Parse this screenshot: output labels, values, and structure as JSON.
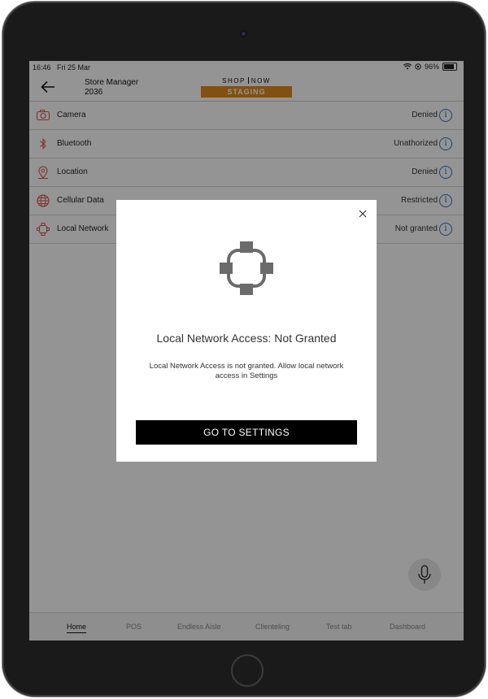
{
  "status_bar": {
    "time": "16:46",
    "date": "Fri 25 Mar",
    "battery": "96%"
  },
  "header": {
    "store_title": "Store Manager",
    "store_number": "2036",
    "brand_left": "SHOP",
    "brand_right": "NOW",
    "env_badge": "STAGING"
  },
  "permissions": [
    {
      "label": "Camera",
      "status": "Denied",
      "icon": "camera-icon"
    },
    {
      "label": "Bluetooth",
      "status": "Unathorized",
      "icon": "bluetooth-icon"
    },
    {
      "label": "Location",
      "status": "Denied",
      "icon": "location-pin-icon"
    },
    {
      "label": "Cellular Data",
      "status": "Restricted",
      "icon": "globe-icon"
    },
    {
      "label": "Local Network",
      "status": "Not granted",
      "icon": "local-network-icon"
    }
  ],
  "info_glyph": "i",
  "tabs": [
    {
      "label": "Home",
      "active": true
    },
    {
      "label": "POS"
    },
    {
      "label": "Endless Aisle"
    },
    {
      "label": "Clienteling"
    },
    {
      "label": "Test tab"
    },
    {
      "label": "Dashboard"
    }
  ],
  "dialog": {
    "title": "Local Network Access: Not Granted",
    "message": "Local Network Access is not granted. Allow local network access in Settings",
    "button_label": "GO TO SETTINGS"
  },
  "colors": {
    "accent_badge": "#e08a1e",
    "icon_red": "#d9534f",
    "info_blue": "#3b6fb6",
    "button_bg": "#000000"
  }
}
